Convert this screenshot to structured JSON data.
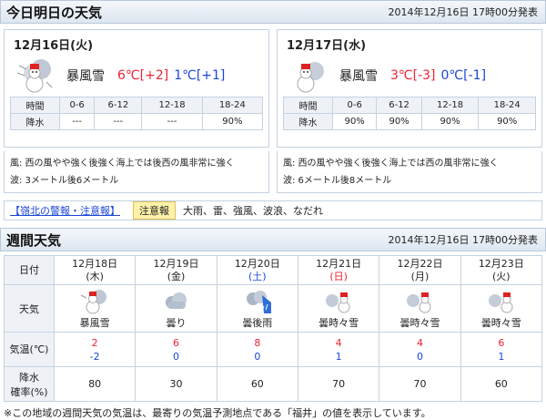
{
  "today": {
    "title": "今日明日の天気",
    "issued": "2014年12月16日 17時00分発表",
    "days": [
      {
        "date": "12月16日(火)",
        "icon": "blizzard-snowman-icon",
        "telop": "暴風雪",
        "max": "6℃[+2]",
        "min": "1℃[+1]",
        "rain_headers": [
          "時間",
          "0-6",
          "6-12",
          "12-18",
          "18-24"
        ],
        "rain_label": "降水",
        "rain_values": [
          "---",
          "---",
          "---",
          "90%"
        ],
        "wind": "風: 西の風やや強く後強く海上では後西の風非常に強く",
        "wave": "波: 3メートル後6メートル"
      },
      {
        "date": "12月17日(水)",
        "icon": "snowman-cloud-icon",
        "telop": "暴風雪",
        "max": "3℃[-3]",
        "min": "0℃[-1]",
        "rain_headers": [
          "時間",
          "0-6",
          "6-12",
          "12-18",
          "18-24"
        ],
        "rain_label": "降水",
        "rain_values": [
          "90%",
          "90%",
          "90%",
          "90%"
        ],
        "wind": "風: 西の風やや強く後強く海上では西の風非常に強く",
        "wave": "波: 6メートル後8メートル"
      }
    ]
  },
  "warning": {
    "link": "【嶺北の警報・注意報】",
    "badge": "注意報",
    "text": "大雨、雷、強風、波浪、なだれ"
  },
  "weekly": {
    "title": "週間天気",
    "issued": "2014年12月16日 17時00分発表",
    "row_labels": {
      "date": "日付",
      "weather": "天気",
      "temp": "気温(℃)",
      "rain_1": "降水",
      "rain_2": "確率(%)"
    },
    "days": [
      {
        "date": "12月18日",
        "dow": "(木)",
        "dow_type": "weekday",
        "icon": "blizzard-snowman-icon",
        "weather": "暴風雪",
        "max": "2",
        "min": "-2",
        "rain": "80"
      },
      {
        "date": "12月19日",
        "dow": "(金)",
        "dow_type": "weekday",
        "icon": "cloud-icon",
        "weather": "曇り",
        "max": "6",
        "min": "0",
        "rain": "30"
      },
      {
        "date": "12月20日",
        "dow": "(土)",
        "dow_type": "sat",
        "icon": "cloud-then-rain-icon",
        "weather": "曇後雨",
        "max": "8",
        "min": "0",
        "rain": "60"
      },
      {
        "date": "12月21日",
        "dow": "(日)",
        "dow_type": "sun",
        "icon": "cloud-snowman-icon",
        "weather": "曇時々雪",
        "max": "4",
        "min": "1",
        "rain": "70"
      },
      {
        "date": "12月22日",
        "dow": "(月)",
        "dow_type": "weekday",
        "icon": "cloud-snowman-icon",
        "weather": "曇時々雪",
        "max": "4",
        "min": "0",
        "rain": "70"
      },
      {
        "date": "12月23日",
        "dow": "(火)",
        "dow_type": "weekday",
        "icon": "cloud-snowman-icon",
        "weather": "曇時々雪",
        "max": "6",
        "min": "1",
        "rain": "60"
      }
    ]
  },
  "footnote": "※この地域の週間天気の気温は、最寄りの気温予測地点である「福井」の値を表示しています。"
}
